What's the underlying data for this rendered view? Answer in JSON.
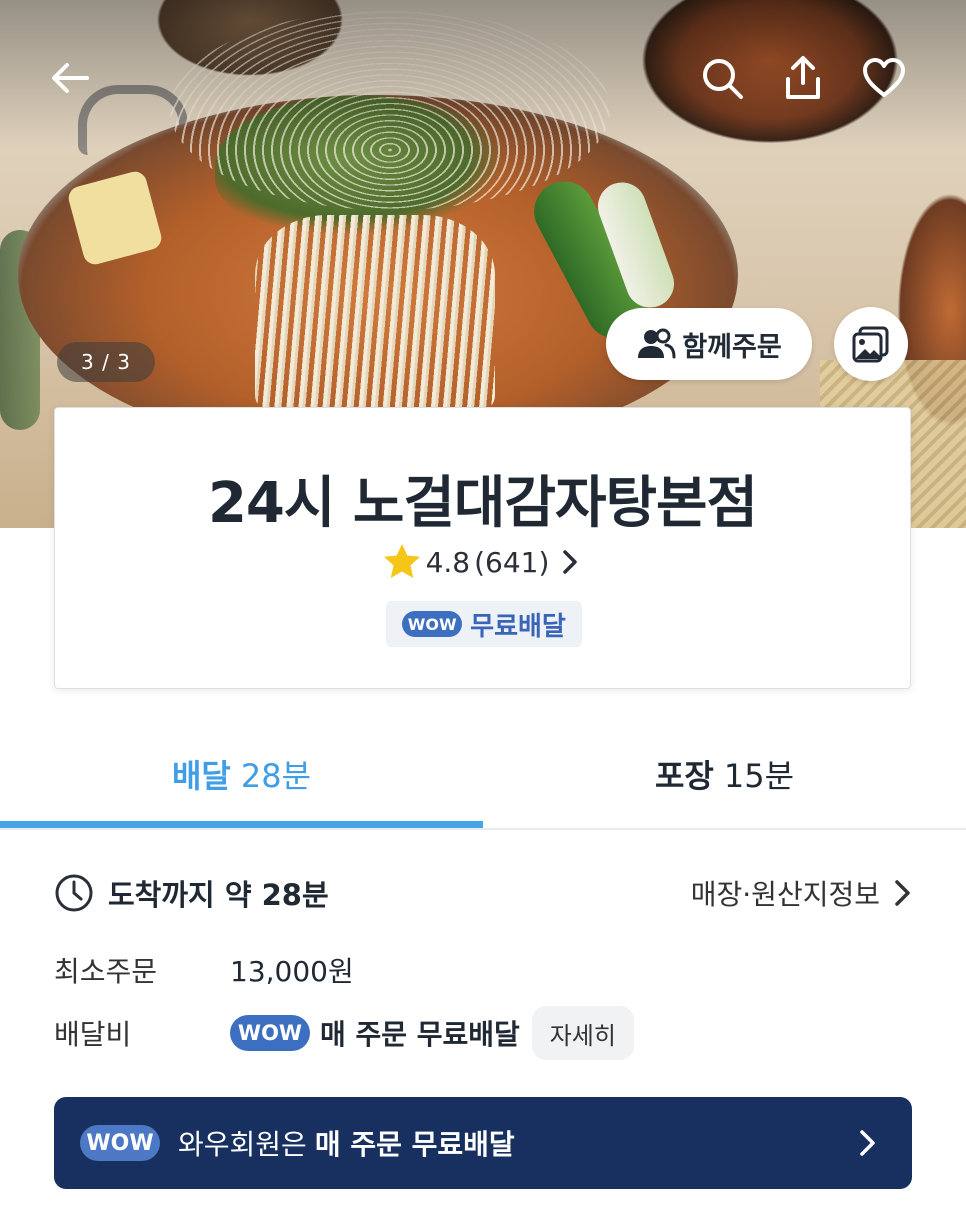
{
  "hero": {
    "pager": "3 / 3",
    "group_order_label": "함께주문"
  },
  "store": {
    "name": "24시 노걸대감자탕본점",
    "rating": "4.8",
    "review_count": "(641)",
    "badge": {
      "wow": "WOW",
      "label": "무료배달"
    }
  },
  "tabs": [
    {
      "label": "배달",
      "time": "28분",
      "active": true
    },
    {
      "label": "포장",
      "time": "15분",
      "active": false
    }
  ],
  "info": {
    "eta": "도착까지 약 28분",
    "store_info_link": "매장·원산지정보",
    "min_order": {
      "label": "최소주문",
      "value": "13,000원"
    },
    "delivery_fee": {
      "label": "배달비",
      "wow": "WOW",
      "value": "매 주문 무료배달",
      "detail": "자세히"
    }
  },
  "banner": {
    "wow": "WOW",
    "lead": "와우회원은",
    "strong": "매 주문 무료배달"
  },
  "colors": {
    "accent_blue": "#45a3ea",
    "wow_blue": "#3d6fc1",
    "banner_navy": "#17305f",
    "star_yellow": "#f5c518"
  },
  "icons": [
    "back-arrow-icon",
    "search-icon",
    "share-icon",
    "heart-icon",
    "people-icon",
    "photo-icon",
    "star-icon",
    "chevron-right-icon",
    "clock-icon"
  ]
}
